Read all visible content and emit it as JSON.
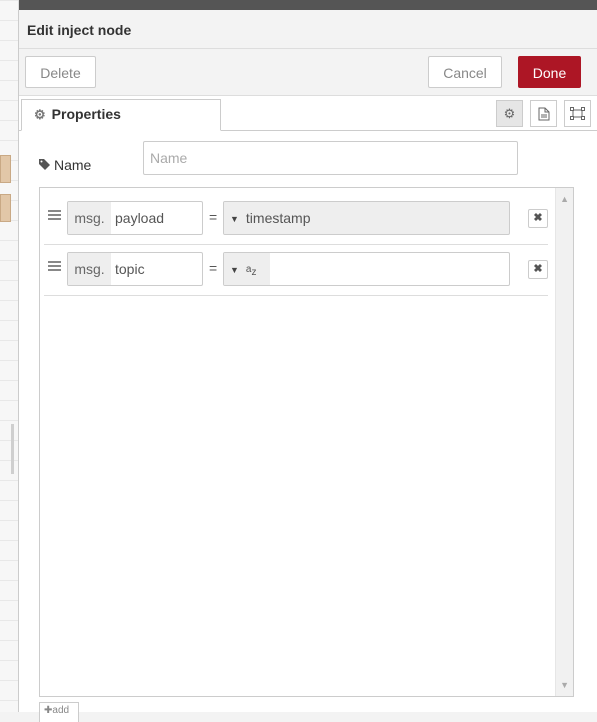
{
  "tray": {
    "title": "Edit inject node"
  },
  "toolbar": {
    "delete_label": "Delete",
    "cancel_label": "Cancel",
    "done_label": "Done"
  },
  "tabs": {
    "properties_label": "Properties"
  },
  "name_field": {
    "label": "Name",
    "placeholder": "Name",
    "value": ""
  },
  "properties": [
    {
      "prefix": "msg.",
      "property": "payload",
      "operator": "=",
      "type_label": "timestamp",
      "type_icon": "caret-down-icon"
    },
    {
      "prefix": "msg.",
      "property": "topic",
      "operator": "=",
      "type_label": "",
      "type_icon": "string-az-icon"
    }
  ],
  "add_label": "add",
  "colors": {
    "primary": "#ad1625",
    "border": "#cccccc"
  }
}
